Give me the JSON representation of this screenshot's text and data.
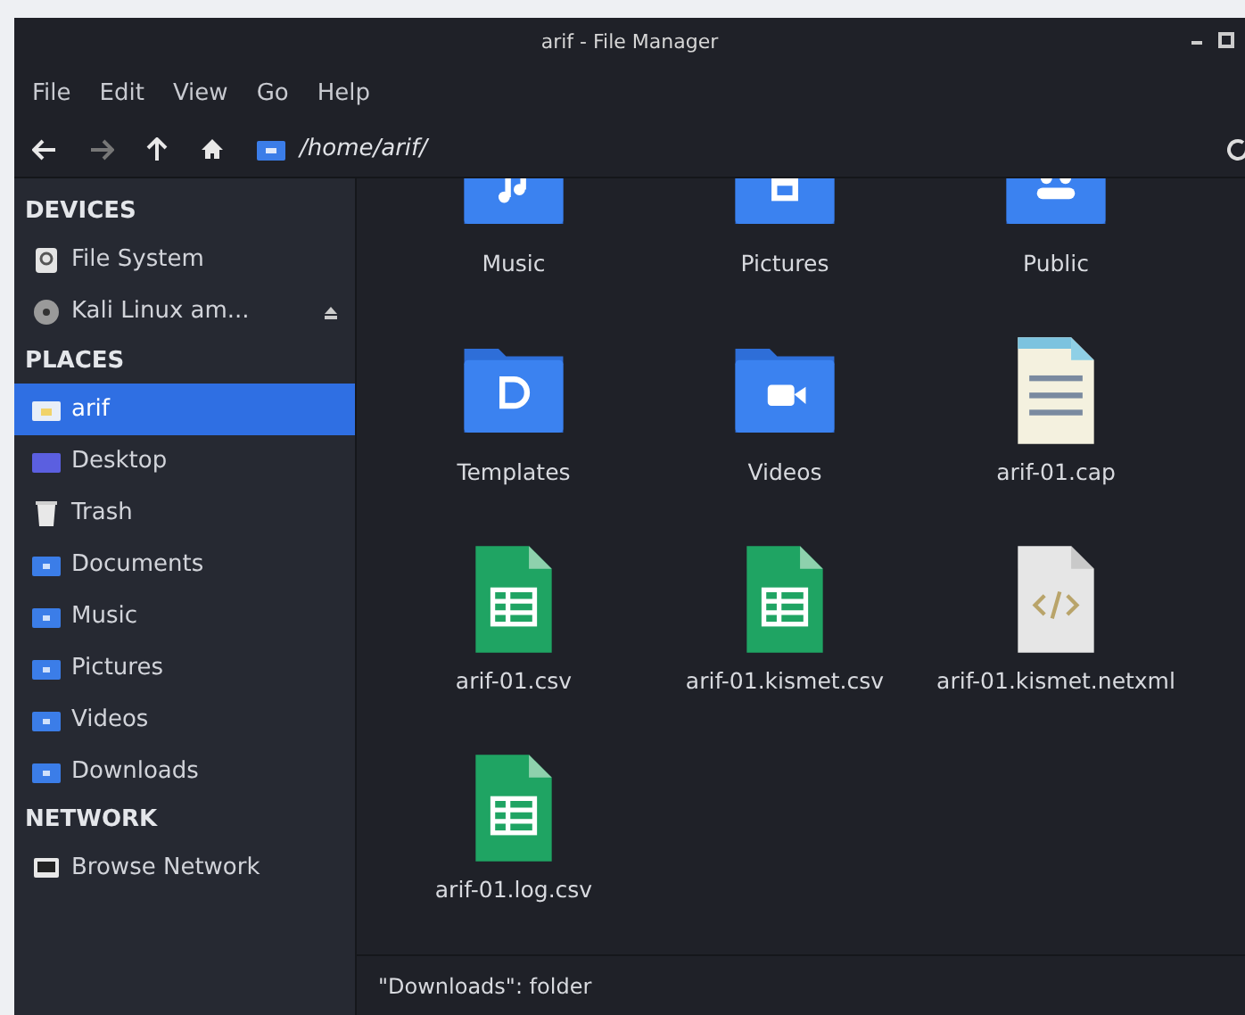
{
  "window": {
    "title": "arif - File Manager"
  },
  "menu": [
    "File",
    "Edit",
    "View",
    "Go",
    "Help"
  ],
  "location": {
    "path": "/home/arif/"
  },
  "sidebar": [
    {
      "heading": "DEVICES",
      "items": [
        {
          "label": "File System",
          "kind": "drive",
          "selected": false,
          "eject": false
        },
        {
          "label": "Kali Linux am...",
          "kind": "disc",
          "selected": false,
          "eject": true
        }
      ]
    },
    {
      "heading": "PLACES",
      "items": [
        {
          "label": "arif",
          "kind": "home",
          "selected": true,
          "eject": false
        },
        {
          "label": "Desktop",
          "kind": "desktop",
          "selected": false,
          "eject": false
        },
        {
          "label": "Trash",
          "kind": "trash",
          "selected": false,
          "eject": false
        },
        {
          "label": "Documents",
          "kind": "folder",
          "selected": false,
          "eject": false
        },
        {
          "label": "Music",
          "kind": "folder",
          "selected": false,
          "eject": false
        },
        {
          "label": "Pictures",
          "kind": "folder",
          "selected": false,
          "eject": false
        },
        {
          "label": "Videos",
          "kind": "folder",
          "selected": false,
          "eject": false
        },
        {
          "label": "Downloads",
          "kind": "folder",
          "selected": false,
          "eject": false
        }
      ]
    },
    {
      "heading": "NETWORK",
      "items": [
        {
          "label": "Browse Network",
          "kind": "network",
          "selected": false,
          "eject": false
        }
      ]
    }
  ],
  "files": [
    {
      "name": "Music",
      "kind": "music-folder"
    },
    {
      "name": "Pictures",
      "kind": "pictures-folder"
    },
    {
      "name": "Public",
      "kind": "public-folder"
    },
    {
      "name": "Templates",
      "kind": "templates-folder"
    },
    {
      "name": "Videos",
      "kind": "videos-folder"
    },
    {
      "name": "arif-01.cap",
      "kind": "capture"
    },
    {
      "name": "arif-01.csv",
      "kind": "spreadsheet"
    },
    {
      "name": "arif-01.kismet.csv",
      "kind": "spreadsheet"
    },
    {
      "name": "arif-01.kismet.netxml",
      "kind": "code"
    },
    {
      "name": "arif-01.log.csv",
      "kind": "spreadsheet"
    }
  ],
  "status_bar": "\"Downloads\": folder"
}
